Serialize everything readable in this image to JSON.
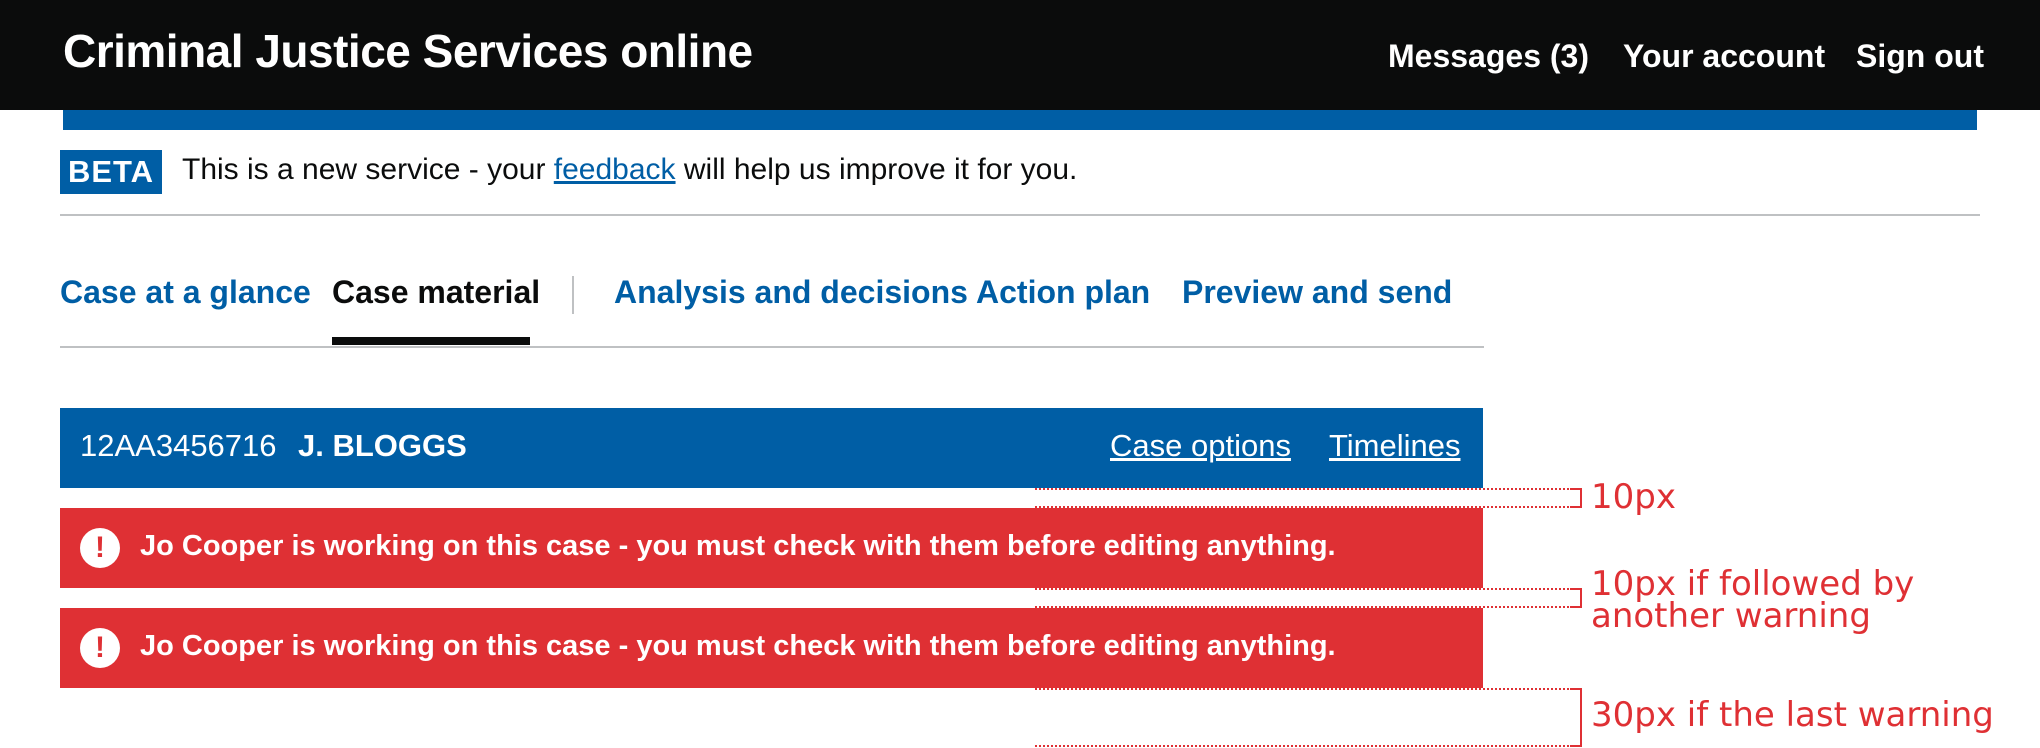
{
  "header": {
    "title": "Criminal Justice Services online",
    "nav": {
      "messages": "Messages (3)",
      "account": "Your account",
      "sign_out": "Sign out"
    }
  },
  "beta_banner": {
    "tag": "BETA",
    "text_before": "This is a new service - your ",
    "link": "feedback",
    "text_after": " will help us improve it for you."
  },
  "tabs": [
    {
      "label": "Case at a glance",
      "active": false
    },
    {
      "label": "Case material",
      "active": true
    },
    {
      "label": "Analysis and decisions",
      "active": false
    },
    {
      "label": "Action plan",
      "active": false
    },
    {
      "label": "Preview and send",
      "active": false
    }
  ],
  "case_banner": {
    "number": "12AA3456716",
    "name": "J. BLOGGS",
    "links": [
      "Case options",
      "Timelines"
    ]
  },
  "warnings": [
    {
      "icon": "exclamation-icon",
      "glyph": "!",
      "text": "Jo Cooper is working on this case - you must check with them before editing anything."
    },
    {
      "icon": "exclamation-icon",
      "glyph": "!",
      "text": "Jo Cooper is working on this case - you must check with them before editing anything."
    }
  ],
  "annotations": {
    "gap_after_banner": "10px",
    "gap_between_warnings_line1": "10px if followed by",
    "gap_between_warnings_line2": "another warning",
    "gap_after_last": "30px if the last warning"
  },
  "colors": {
    "header_bg": "#0b0c0c",
    "brand_blue": "#005ea5",
    "warning_red": "#df3034",
    "rule_grey": "#bfc1c3"
  }
}
